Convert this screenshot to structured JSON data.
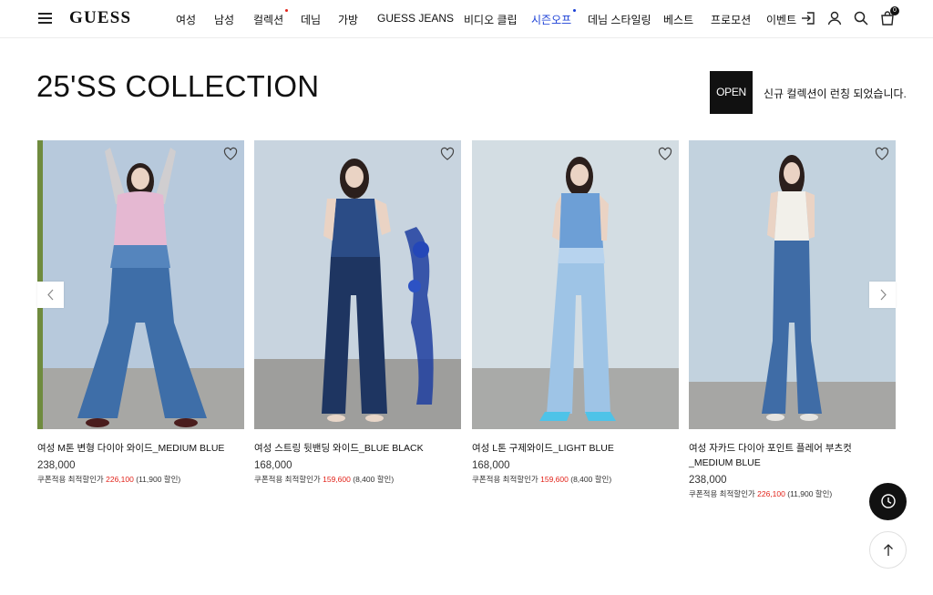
{
  "header": {
    "logo": "GUESS",
    "menu_icon": "hamburger-menu-icon",
    "nav": [
      {
        "label": "여성"
      },
      {
        "label": "남성"
      },
      {
        "label": "컬렉션",
        "dot": "red"
      },
      {
        "label": "데님"
      },
      {
        "label": "가방"
      },
      {
        "label": "GUESS JEANS"
      },
      {
        "label": "비디오 클립"
      },
      {
        "label": "시즌오프",
        "dot": "blue",
        "active": true
      },
      {
        "label": "데님 스타일링"
      },
      {
        "label": "베스트"
      },
      {
        "label": "프로모션"
      },
      {
        "label": "이벤트"
      }
    ],
    "icons": [
      "login-icon",
      "user-icon",
      "search-icon",
      "cart-icon"
    ],
    "cart_count": "0"
  },
  "section": {
    "title": "25'SS COLLECTION",
    "open_label": "OPEN",
    "open_text": "신규 컬렉션이 런칭 되었습니다."
  },
  "products": [
    {
      "name": "여성 M톤 변형 다이아 와이드_MEDIUM BLUE",
      "price": "238,000",
      "coupon_label": "쿠폰적용 최적할인가",
      "coupon_price": "226,100",
      "discount": "(11,900 할인)"
    },
    {
      "name": "여성 스트링 뒷밴딩 와이드_BLUE BLACK",
      "price": "168,000",
      "coupon_label": "쿠폰적용 최적할인가",
      "coupon_price": "159,600",
      "discount": "(8,400 할인)"
    },
    {
      "name": "여성 L톤 구제와이드_LIGHT BLUE",
      "price": "168,000",
      "coupon_label": "쿠폰적용 최적할인가",
      "coupon_price": "159,600",
      "discount": "(8,400 할인)"
    },
    {
      "name": "여성 자카드 다이아 포인트 플레어 부츠컷_MEDIUM BLUE",
      "price": "238,000",
      "coupon_label": "쿠폰적용 최적할인가",
      "coupon_price": "226,100",
      "discount": "(11,900 할인)"
    }
  ],
  "colors": {
    "accent_blue": "#1a3fd6",
    "sale_red": "#e2231a",
    "text": "#111111"
  },
  "floating": {
    "recent_icon": "clock-icon",
    "top_icon": "arrow-up-icon"
  }
}
